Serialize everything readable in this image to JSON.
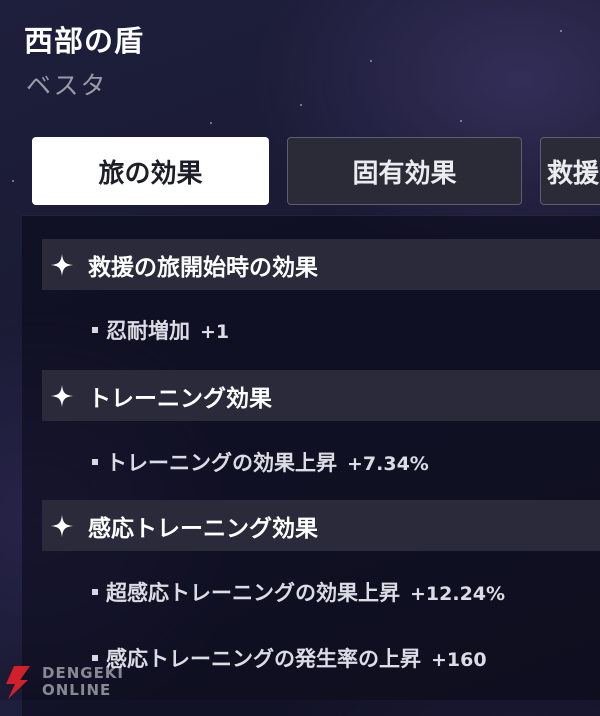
{
  "card": {
    "title": "西部の盾",
    "subtitle": "ベスタ"
  },
  "tabs": [
    {
      "label": "旅の効果",
      "active": true
    },
    {
      "label": "固有効果",
      "active": false
    },
    {
      "label": "救援",
      "active": false
    }
  ],
  "sections": [
    {
      "icon": "sparkle-icon",
      "title": "救援の旅開始時の効果",
      "effects": [
        {
          "label": "忍耐増加",
          "value": "+1"
        }
      ]
    },
    {
      "icon": "sparkle-icon",
      "title": "トレーニング効果",
      "effects": [
        {
          "label": "トレーニングの効果上昇",
          "value": "+7.34%"
        }
      ]
    },
    {
      "icon": "sparkle-icon",
      "title": "感応トレーニング効果",
      "effects": [
        {
          "label": "超感応トレーニングの効果上昇",
          "value": "+12.24%"
        },
        {
          "label": "感応トレーニングの発生率の上昇",
          "value": "+160"
        }
      ]
    }
  ],
  "watermark": {
    "line1": "DENGEKI",
    "line2": "ONLINE",
    "logo_color": "#d0202a"
  }
}
